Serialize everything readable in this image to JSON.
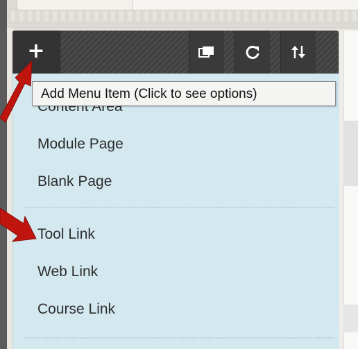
{
  "toolbar": {
    "add_glyph": "+",
    "tooltip": "Add Menu Item (Click to see options)"
  },
  "menu": {
    "items": [
      {
        "label": "Content Area"
      },
      {
        "label": "Module Page"
      },
      {
        "label": "Blank Page"
      },
      {
        "label": "Tool Link"
      },
      {
        "label": "Web Link"
      },
      {
        "label": "Course Link"
      }
    ]
  },
  "colors": {
    "toolbar": "#3a3a3a",
    "menu_bg": "#d3e9ef",
    "arrow": "#c0150f",
    "tooltip_bg": "#f4f4f2"
  },
  "icons": [
    "plus-icon",
    "display-toggle-icon",
    "refresh-icon",
    "sort-icon"
  ]
}
